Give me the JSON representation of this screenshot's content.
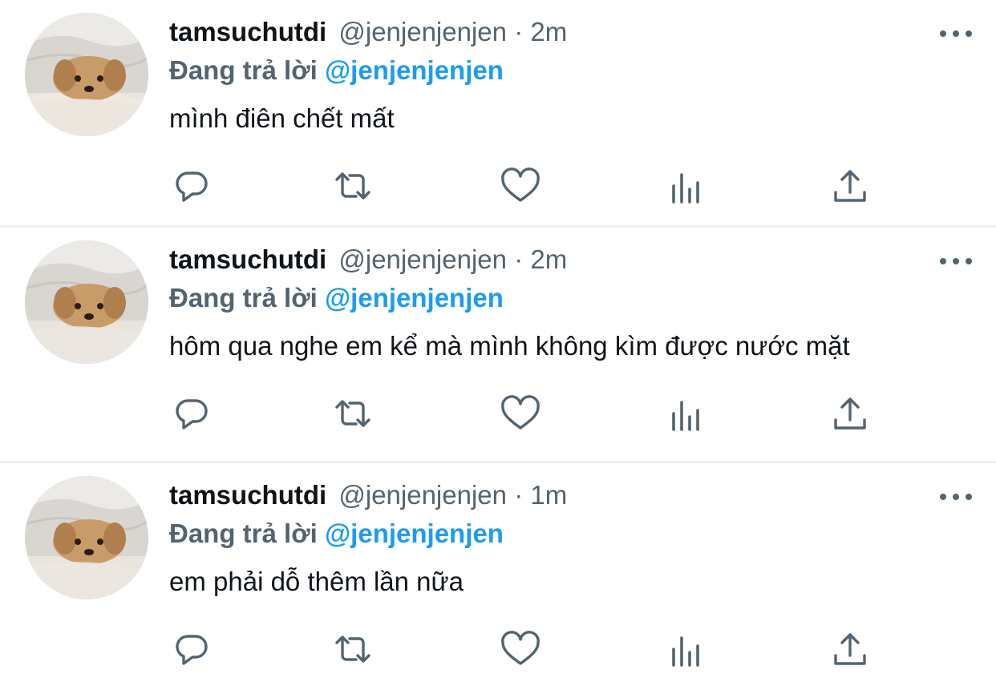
{
  "tweets": [
    {
      "author_name": "tamsuchutdi",
      "author_handle": "@jenjenjenjen",
      "separator": "·",
      "time": "2m",
      "reply_prefix": "Đang trả lời",
      "reply_to": "@jenjenjenjen",
      "text": "mình điên chết mất"
    },
    {
      "author_name": "tamsuchutdi",
      "author_handle": "@jenjenjenjen",
      "separator": "·",
      "time": "2m",
      "reply_prefix": "Đang trả lời",
      "reply_to": "@jenjenjenjen",
      "text": "hôm qua nghe em kể mà mình không kìm được nước mặt"
    },
    {
      "author_name": "tamsuchutdi",
      "author_handle": "@jenjenjenjen",
      "separator": "·",
      "time": "1m",
      "reply_prefix": "Đang trả lời",
      "reply_to": "@jenjenjenjen",
      "text": "em phải dỗ thêm lần nữa"
    }
  ],
  "icons": {
    "reply": "reply-icon",
    "retweet": "retweet-icon",
    "like": "like-icon",
    "views": "views-icon",
    "share": "share-icon",
    "more": "more-icon"
  },
  "colors": {
    "text_primary": "#0f1419",
    "text_secondary": "#536471",
    "link": "#1d9bf0",
    "divider": "#eceef0"
  }
}
